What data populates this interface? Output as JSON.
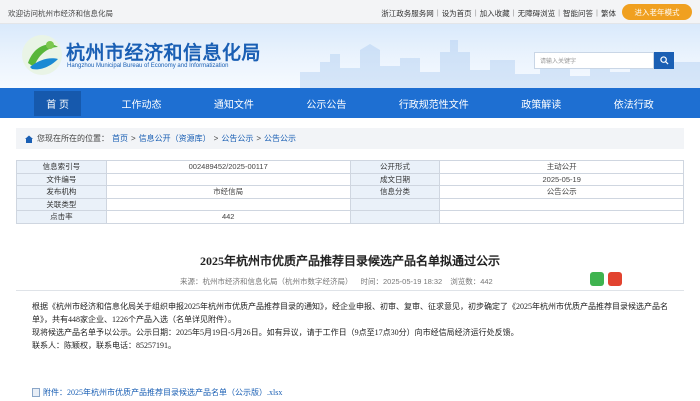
{
  "topbar": {
    "welcome": "欢迎访问杭州市经济和信息化局",
    "links": [
      "浙江政务服务网",
      "设为首页",
      "加入收藏",
      "无障碍浏览",
      "智能问答",
      "繁体"
    ],
    "elder_mode": "进入老年模式"
  },
  "header": {
    "title": "杭州市经济和信息化局",
    "subtitle": "Hangzhou Municipal Bureau of Economy and Informatization",
    "search_placeholder": "请输入关键字"
  },
  "nav": {
    "items": [
      "首 页",
      "工作动态",
      "通知文件",
      "公示公告",
      "行政规范性文件",
      "政策解读",
      "依法行政"
    ]
  },
  "breadcrumb": {
    "label": "您现在所在的位置：",
    "items": [
      "首页",
      "信息公开（资源库）",
      "公告公示",
      "公告公示"
    ],
    "separator": ">"
  },
  "info_table": {
    "rows": [
      {
        "k1": "信息索引号",
        "v1": "002489452/2025-00117",
        "k2": "公开形式",
        "v2": "主动公开"
      },
      {
        "k1": "文件编号",
        "v1": "",
        "k2": "成文日期",
        "v2": "2025-05-19"
      },
      {
        "k1": "发布机构",
        "v1": "市经信局",
        "k2": "信息分类",
        "v2": "公告公示"
      },
      {
        "k1": "关联类型",
        "v1": "",
        "k2": "",
        "v2": ""
      },
      {
        "k1": "点击率",
        "v1": "442",
        "k2": "",
        "v2": ""
      }
    ]
  },
  "article": {
    "title": "2025年杭州市优质产品推荐目录候选产品名单拟通过公示",
    "source": "来源：杭州市经济和信息化局（杭州市数字经济局）",
    "time": "时间：2025-05-19 18:32",
    "views": "浏览数：442",
    "paragraphs": [
      "根据《杭州市经济和信息化局关于组织申报2025年杭州市优质产品推荐目录的通知》，经企业申报、初审、复审、征求意见，初步确定了《2025年杭州市优质产品推荐目录候选产品名单》，共有448家企业、1226个产品入选（名单详见附件）。",
      "现将候选产品名单予以公示。公示日期：2025年5月19日-5月26日。如有异议，请于工作日（9点至17点30分）向市经信局经济运行处反馈。",
      "联系人：陈颖权，联系电话：85257191。"
    ],
    "attachment": "附件：2025年杭州市优质产品推荐目录候选产品名单（公示版）.xlsx"
  },
  "colors": {
    "nav_blue": "#1e6fd2",
    "accent_orange": "#f0a020",
    "title_blue": "#1a5fb4"
  }
}
